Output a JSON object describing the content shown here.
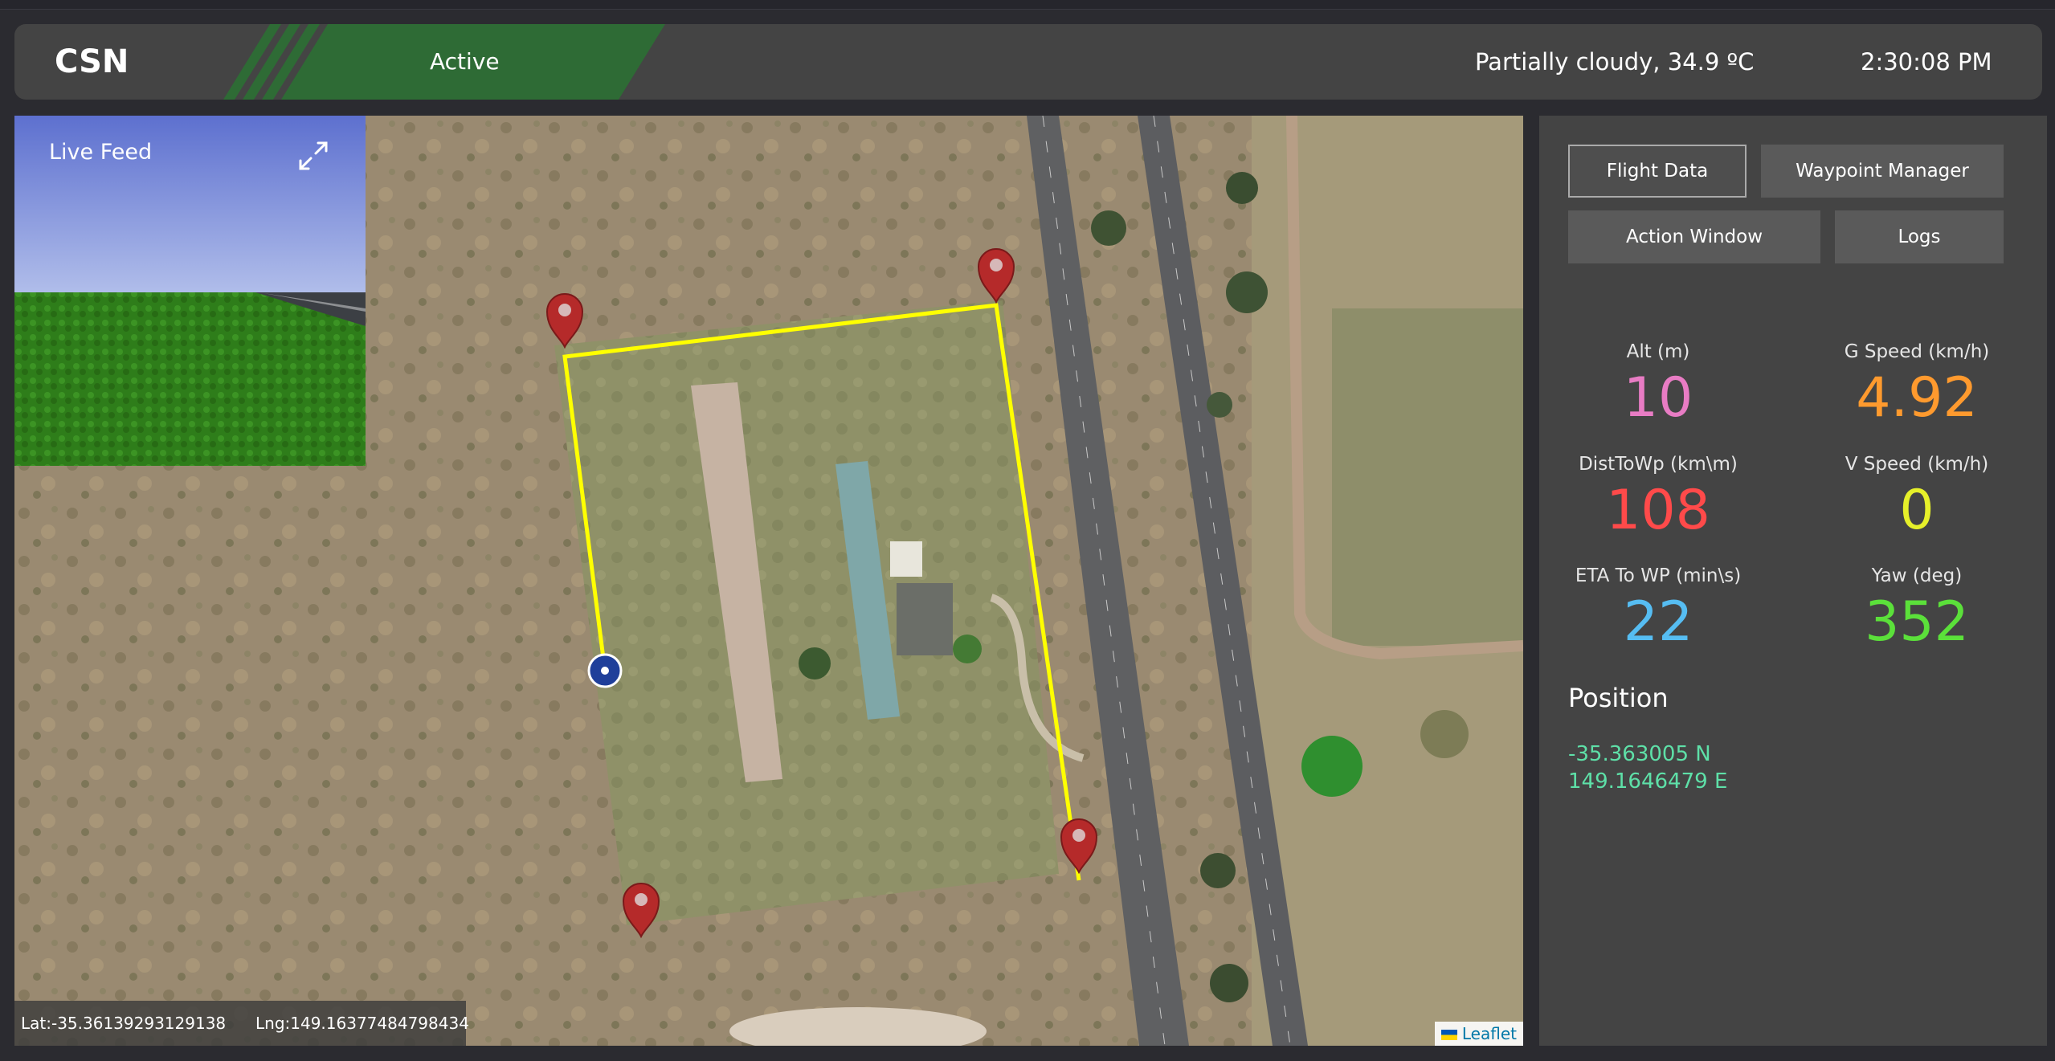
{
  "header": {
    "brand": "CSN",
    "status": "Active",
    "weather": "Partially cloudy, 34.9 ºC",
    "time": "2:30:08 PM",
    "status_color": "#2e6b35"
  },
  "live_feed": {
    "title": "Live Feed",
    "expand_icon": "expand-arrows-icon"
  },
  "map": {
    "lat_label": "Lat:-35.36139293129138",
    "lng_label": "Lng:149.16377484798434",
    "attribution": "Leaflet",
    "route_color": "#ffff00",
    "marker_color": "#b52a2a",
    "vehicle_color": "#1f3f9a"
  },
  "tabs": {
    "flight_data": "Flight Data",
    "waypoint_manager": "Waypoint Manager",
    "action_window": "Action Window",
    "logs": "Logs"
  },
  "stats": {
    "alt": {
      "label": "Alt (m)",
      "value": "10",
      "color": "#e87cc4"
    },
    "gspeed": {
      "label": "G Speed (km/h)",
      "value": "4.92",
      "color": "#ff9a2e"
    },
    "dist": {
      "label": "DistToWp (km\\m)",
      "value": "108",
      "color": "#ff4a4a"
    },
    "vspeed": {
      "label": "V Speed (km/h)",
      "value": "0",
      "color": "#e6f02a"
    },
    "eta": {
      "label": "ETA To WP (min\\s)",
      "value": "22",
      "color": "#56bdf2"
    },
    "yaw": {
      "label": "Yaw (deg)",
      "value": "352",
      "color": "#5be03a"
    }
  },
  "position": {
    "title": "Position",
    "lat": "-35.363005 N",
    "lng": "149.1646479 E",
    "color": "#5ee0a8"
  }
}
